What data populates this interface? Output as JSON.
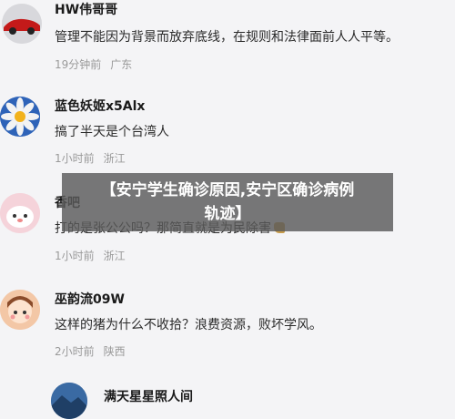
{
  "comments": [
    {
      "name": "HW伟哥哥",
      "text": "管理不能因为背景而放弃底线，在规则和法律面前人人平等。",
      "time": "19分钟前",
      "location": "广东",
      "avatar": "car-avatar-icon"
    },
    {
      "name": "蓝色妖姬x5Alx",
      "text": "搞了半天是个台湾人",
      "time": "1小时前",
      "location": "浙江",
      "avatar": "flower-avatar-icon"
    },
    {
      "name": "香吧",
      "text": "打的是张公公吗？那简直就是为民除害",
      "time": "1小时前",
      "location": "浙江",
      "avatar": "cartoon-avatar-icon"
    },
    {
      "name": "巫韵流09W",
      "text": "这样的猪为什么不收拾？浪费资源，败坏学风。",
      "time": "2小时前",
      "location": "陕西",
      "avatar": "cartoon-girl-avatar-icon"
    },
    {
      "name": "满天星星照人间",
      "text": "",
      "time": "",
      "location": "",
      "avatar": "landscape-avatar-icon"
    }
  ],
  "banner": {
    "line1": "【安宁学生确诊原因,安宁区确诊病例",
    "line2": "轨迹】"
  },
  "colors": {
    "background": "#f4f4f6",
    "banner_bg": "#5a5a5a",
    "meta": "#9a9a9a"
  }
}
